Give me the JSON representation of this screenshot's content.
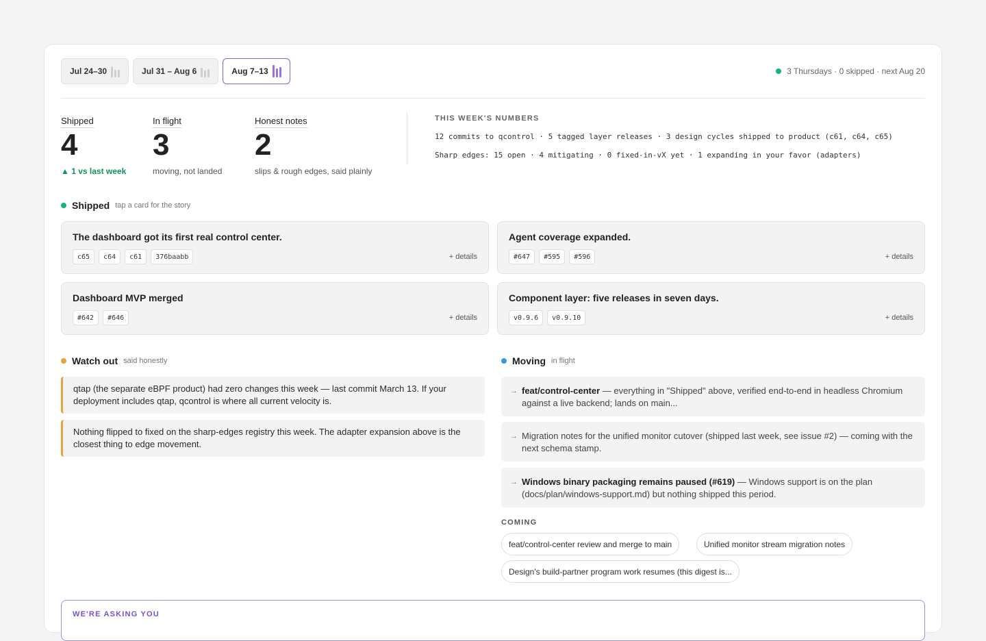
{
  "weeks": [
    {
      "label": "Jul 24–30"
    },
    {
      "label": "Jul 31 – Aug 6"
    },
    {
      "label": "Aug 7–13"
    }
  ],
  "status": {
    "text": "3 Thursdays · 0 skipped · next Aug 20",
    "color": "#16b37a"
  },
  "stats": {
    "shipped": {
      "label": "Shipped",
      "value": "4",
      "sub": "▲ 1 vs last week"
    },
    "in_flight": {
      "label": "In flight",
      "value": "3",
      "sub": "moving, not landed"
    },
    "honest": {
      "label": "Honest notes",
      "value": "2",
      "sub": "slips & rough edges, said plainly"
    }
  },
  "numbers": {
    "title": "THIS WEEK'S NUMBERS",
    "line1": "12 commits to qcontrol · 5 tagged layer releases · 3 design cycles shipped to product (c61, c64, c65)",
    "line2": "Sharp edges: 15 open · 4 mitigating · 0 fixed-in-vX yet · 1 expanding in your favor (adapters)"
  },
  "shipped": {
    "title": "Shipped",
    "hint": "tap a card for the story",
    "color": "#16b37a",
    "details_label": "+ details",
    "cards": [
      {
        "title": "The dashboard got its first real control center.",
        "chips": [
          "c65",
          "c64",
          "c61",
          "376baabb"
        ]
      },
      {
        "title": "Agent coverage expanded.",
        "chips": [
          "#647",
          "#595",
          "#596"
        ]
      },
      {
        "title": "Dashboard MVP merged",
        "chips": [
          "#642",
          "#646"
        ]
      },
      {
        "title": "Component layer: five releases in seven days.",
        "chips": [
          "v0.9.6",
          "v0.9.10"
        ]
      }
    ]
  },
  "watch": {
    "title": "Watch out",
    "hint": "said honestly",
    "color": "#e9a23b",
    "items": [
      "qtap (the separate eBPF product) had zero changes this week — last commit March 13. If your deployment includes qtap, qcontrol is where all current velocity is.",
      "Nothing flipped to fixed on the sharp-edges registry this week. The adapter expansion above is the closest thing to edge movement."
    ]
  },
  "moving": {
    "title": "Moving",
    "hint": "in flight",
    "color": "#2f9be8",
    "items": [
      {
        "bold": "feat/control-center",
        "text": " — everything in \"Shipped\" above, verified end-to-end in headless Chromium against a live backend; lands on main..."
      },
      {
        "bold": "",
        "text": "Migration notes for the unified monitor cutover (shipped last week, see issue #2) — coming with the next schema stamp."
      },
      {
        "bold": "Windows binary packaging remains paused (#619)",
        "text": " — Windows support is on the plan (docs/plan/windows-support.md) but nothing shipped this period."
      }
    ]
  },
  "coming": {
    "title": "COMING",
    "items": [
      "feat/control-center review and merge to main",
      "Unified monitor stream migration notes",
      "Design's build-partner program work resumes (this digest is..."
    ]
  },
  "ask": {
    "title": "WE'RE ASKING YOU"
  }
}
